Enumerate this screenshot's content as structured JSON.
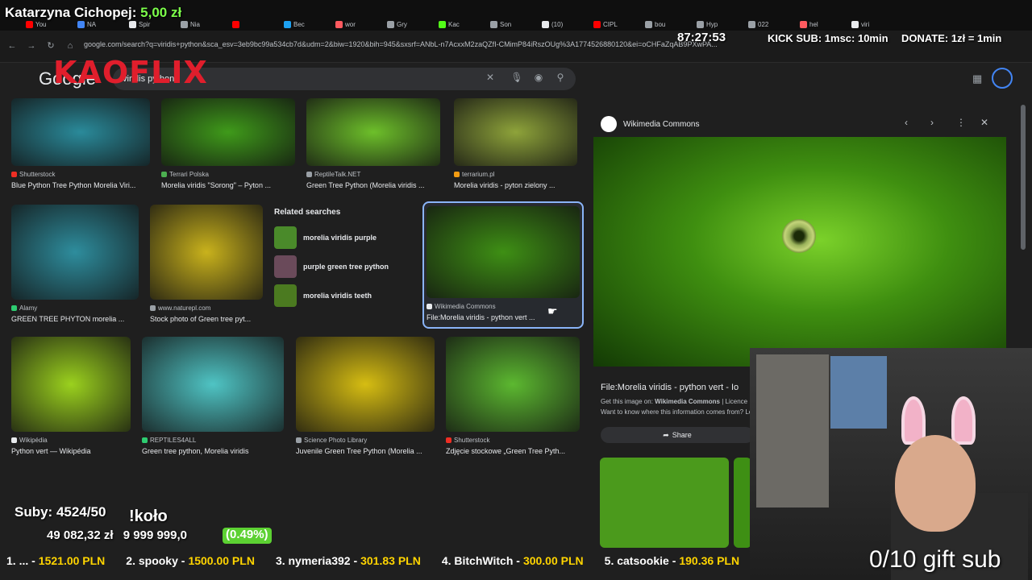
{
  "overlay": {
    "streamer": "Katarzyna Cichopej:",
    "amount": "5,00 zł",
    "timer": "87:27:53",
    "kick_sub": "KICK SUB: 1msc: 10min",
    "donate": "DONATE: 1zł = 1min",
    "logo": "KAOFLIX",
    "subs": "Suby: 4524/50",
    "kolo": "!koło",
    "goal_current": "49 082,32 zł",
    "goal_target": "9 999 999,0",
    "goal_pct": "(0.49%)",
    "gift_sub": "0/10 gift sub",
    "ticker": [
      {
        "name": "1. ... -",
        "amount": "1521.00 PLN"
      },
      {
        "name": "2. spooky -",
        "amount": "1500.00 PLN"
      },
      {
        "name": "3. nymeria392 -",
        "amount": "301.83 PLN"
      },
      {
        "name": "4. BitchWitch -",
        "amount": "300.00 PLN"
      },
      {
        "name": "5. catsookie -",
        "amount": "190.36 PLN"
      }
    ]
  },
  "browser": {
    "tabs": [
      {
        "label": "You",
        "color": "#ff0000"
      },
      {
        "label": "NA",
        "color": "#4285f4"
      },
      {
        "label": "Spir",
        "color": "#e8eaed"
      },
      {
        "label": "Nia",
        "color": "#9aa0a6"
      },
      {
        "label": "",
        "color": "#ff0000"
      },
      {
        "label": "Bec",
        "color": "#1da1f2"
      },
      {
        "label": "wor",
        "color": "#ff5a5f"
      },
      {
        "label": "Gry",
        "color": "#9aa0a6"
      },
      {
        "label": "Kac",
        "color": "#53fc18"
      },
      {
        "label": "Son",
        "color": "#9aa0a6"
      },
      {
        "label": "(10)",
        "color": "#e8eaed"
      },
      {
        "label": "CIPL",
        "color": "#ff0000"
      },
      {
        "label": "bou",
        "color": "#9aa0a6"
      },
      {
        "label": "Hyp",
        "color": "#9aa0a6"
      },
      {
        "label": "022",
        "color": "#9aa0a6"
      },
      {
        "label": "hel",
        "color": "#ff5a5f"
      },
      {
        "label": "viri",
        "color": "#e8eaed"
      }
    ],
    "url": "google.com/search?q=viridis+python&sca_esv=3eb9bc99a534cb7d&udm=2&biw=1920&bih=945&sxsrf=ANbL-n7AcxxM2zaQZfI-CMimP84iRszOUg%3A1774526880120&ei=oCHFaZqAB9PXwPA..."
  },
  "google": {
    "logo": "Google",
    "query": "viridis python",
    "icons": [
      "close-icon",
      "mic-icon",
      "lens-icon",
      "search-icon"
    ]
  },
  "results": [
    {
      "source": "Shutterstock",
      "caption": "Blue Python Tree Python Morelia Viri...",
      "color": "#2a8a9a",
      "src_color": "#ee2e24"
    },
    {
      "source": "Terrari Polska",
      "caption": "Morelia viridis \"Sorong\" – Pyton ...",
      "color": "#3f9a1a",
      "src_color": "#4caf50"
    },
    {
      "source": "ReptileTalk.NET",
      "caption": "Green Tree Python (Morelia viridis ...",
      "color": "#6dbf2a",
      "src_color": "#9aa0a6"
    },
    {
      "source": "terrarium.pl",
      "caption": "Morelia viridis - pyton zielony ...",
      "color": "#8ea33a",
      "src_color": "#f39c12"
    },
    {
      "source": "Alamy",
      "caption": "GREEN TREE PHYTON morelia ...",
      "color": "#2e8d9d",
      "src_color": "#2ecc71"
    },
    {
      "source": "www.naturepl.com",
      "caption": "Stock photo of Green tree pyt...",
      "color": "#c9b21c",
      "src_color": "#9aa0a6"
    },
    {
      "source": "Wikimedia Commons",
      "caption": "File:Morelia viridis - python vert ...",
      "color": "#3e8f14",
      "src_color": "#e8eaed"
    },
    {
      "source": "Wikipédia",
      "caption": "Python vert — Wikipédia",
      "color": "#9bd11e",
      "src_color": "#e8eaed"
    },
    {
      "source": "REPTILES4ALL",
      "caption": "Green tree python, Morelia viridis",
      "color": "#4fc4c4",
      "src_color": "#2ecc71"
    },
    {
      "source": "Science Photo Library",
      "caption": "Juvenile Green Tree Python (Morelia ...",
      "color": "#d6bd12",
      "src_color": "#9aa0a6"
    },
    {
      "source": "Shutterstock",
      "caption": "Zdjęcie stockowe „Green Tree Pyth...",
      "color": "#5cb830",
      "src_color": "#ee2e24"
    }
  ],
  "related": {
    "title": "Related searches",
    "items": [
      {
        "label_plain": "morelia viridis ",
        "label_bold": "purple",
        "color": "#4a8a2a"
      },
      {
        "label_plain": "purple green tree ",
        "label_bold": "python",
        "color": "#6a4a5a"
      },
      {
        "label_plain": "morelia viridis ",
        "label_bold": "teeth",
        "color": "#4b7a20"
      }
    ]
  },
  "panel": {
    "source": "Wikimedia Commons",
    "title": "File:Morelia viridis - python vert - Io",
    "info_prefix": "Get this image on:",
    "info_source": "Wikimedia Commons",
    "info_suffix": "| Licence",
    "info2": "Want to know where this information comes from? Le",
    "share": "Share"
  }
}
